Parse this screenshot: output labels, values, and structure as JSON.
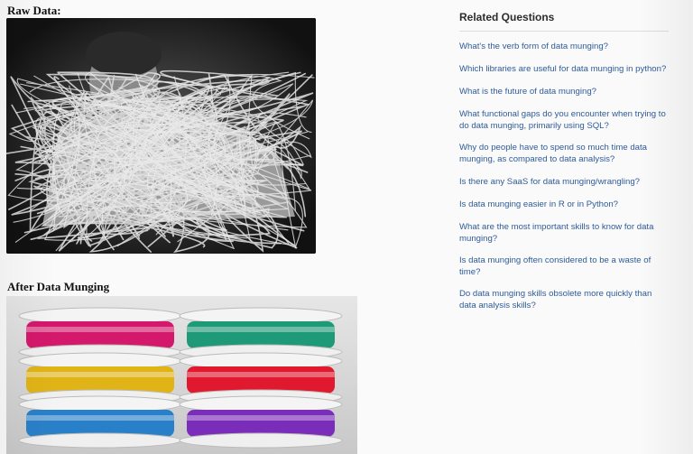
{
  "raw": {
    "heading": "Raw Data:"
  },
  "after": {
    "heading": "After Data Munging"
  },
  "related": {
    "title": "Related Questions",
    "questions": [
      "What's the verb form of data munging?",
      "Which libraries are useful for data munging in python?",
      "What is the future of data munging?",
      "What functional gaps do you encounter when trying to do data munging, primarily using SQL?",
      "Why do people have to spend so much time data munging, as compared to data analysis?",
      "Is there any SaaS for data munging/wrangling?",
      "Is data munging easier in R or in Python?",
      "What are the most important skills to know for data munging?",
      "Is data munging often considered to be a waste of time?",
      "Do data munging skills obsolete more quickly than data analysis skills?"
    ]
  },
  "colors": {
    "link": "#2e5b9a",
    "spool_wires": [
      "#d4186b",
      "#1f9a78",
      "#e0b417",
      "#e0192f",
      "#2a80c8",
      "#7a2db8"
    ]
  }
}
